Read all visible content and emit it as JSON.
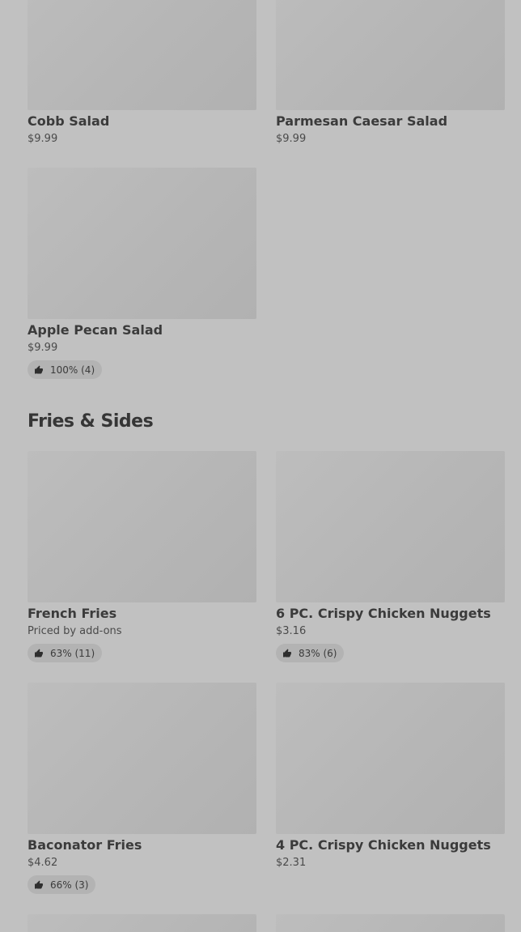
{
  "items": [
    {
      "name": "Cobb Salad",
      "price": "$9.99"
    },
    {
      "name": "Parmesan Caesar Salad",
      "price": "$9.99"
    },
    {
      "name": "Apple Pecan Salad",
      "price": "$9.99",
      "rating": "100% (4)"
    }
  ],
  "section": {
    "title": "Fries & Sides"
  },
  "sides": [
    {
      "name": "French Fries",
      "price": "Priced by add-ons",
      "rating": "63% (11)"
    },
    {
      "name": "6 PC. Crispy Chicken Nuggets",
      "price": "$3.16",
      "rating": "83% (6)"
    },
    {
      "name": "Baconator Fries",
      "price": "$4.62",
      "rating": "66% (3)"
    },
    {
      "name": "4 PC. Crispy Chicken Nuggets",
      "price": "$2.31"
    }
  ]
}
